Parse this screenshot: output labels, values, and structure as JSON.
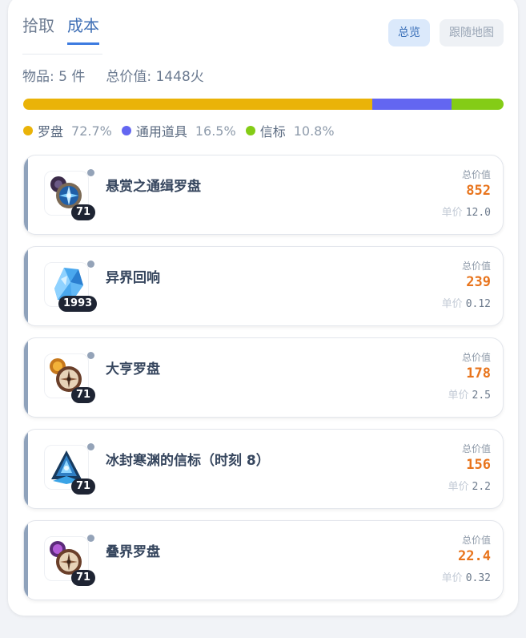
{
  "tabs": [
    {
      "label": "拾取",
      "active": false
    },
    {
      "label": "成本",
      "active": true
    }
  ],
  "buttons": {
    "overview": "总览",
    "follow_map": "跟随地图"
  },
  "summary": {
    "items_label": "物品: 5 件",
    "total_label": "总价值: 1448火"
  },
  "distribution": [
    {
      "name": "罗盘",
      "percent": "72.7%",
      "value": 72.7,
      "color": "#eab308"
    },
    {
      "name": "通用道具",
      "percent": "16.5%",
      "value": 16.5,
      "color": "#6366f1"
    },
    {
      "name": "信标",
      "percent": "10.8%",
      "value": 10.8,
      "color": "#84cc16"
    }
  ],
  "items": [
    {
      "name": "悬赏之通缉罗盘",
      "count": "71",
      "total_label": "总价值",
      "total": "852",
      "unit_label": "单价",
      "unit": "12.0",
      "icon": "wanted-compass-icon"
    },
    {
      "name": "异界回响",
      "count": "1993",
      "total_label": "总价值",
      "total": "239",
      "unit_label": "单价",
      "unit": "0.12",
      "icon": "crystal-shard-icon"
    },
    {
      "name": "大亨罗盘",
      "count": "71",
      "total_label": "总价值",
      "total": "178",
      "unit_label": "单价",
      "unit": "2.5",
      "icon": "tycoon-compass-icon"
    },
    {
      "name": "冰封寒渊的信标（时刻 8）",
      "count": "71",
      "total_label": "总价值",
      "total": "156",
      "unit_label": "单价",
      "unit": "2.2",
      "icon": "frozen-beacon-icon"
    },
    {
      "name": "叠界罗盘",
      "count": "71",
      "total_label": "总价值",
      "total": "22.4",
      "unit_label": "单价",
      "unit": "0.32",
      "icon": "overlap-compass-icon"
    }
  ]
}
